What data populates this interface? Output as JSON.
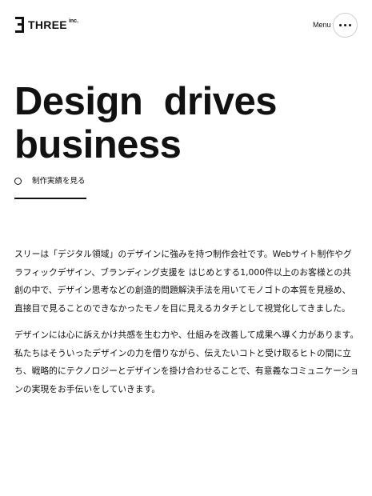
{
  "header": {
    "logo_text": "THREE",
    "logo_suffix": "inc.",
    "menu_label": "Menu"
  },
  "hero": {
    "headline_line1": "Design  drives",
    "headline_line2": "business",
    "works_link_label": "制作実績を見る"
  },
  "intro": {
    "paragraph1": "スリーは「デジタル領域」のデザインに強みを持つ制作会社です。Webサイト制作やグラフィックデザイン、ブランディング支援を はじめとする1,000件以上のお客様との共創の中で、デザイン思考などの創造的問題解決手法を用いてモノゴトの本質を見極め、直接目で見ることのできなかったモノを目に見えるカタチとして視覚化してきました。",
    "paragraph2": "デザインには心に訴えかけ共感を生む力や、仕組みを改善して成果へ導く力があります。私たちはそういったデザインの力を借りながら、伝えたいコトと受け取るヒトの間に立ち、戦略的にテクノロジーとデザインを掛け合わせることで、有意義なコミュニケーションの実現をお手伝いをしていきます。"
  },
  "colors": {
    "text": "#111111",
    "background": "#ffffff",
    "menu_border": "#cfcfcf"
  },
  "icons": {
    "logo": "three-logo-icon",
    "menu": "more-dots-icon",
    "link": "circle-icon"
  }
}
